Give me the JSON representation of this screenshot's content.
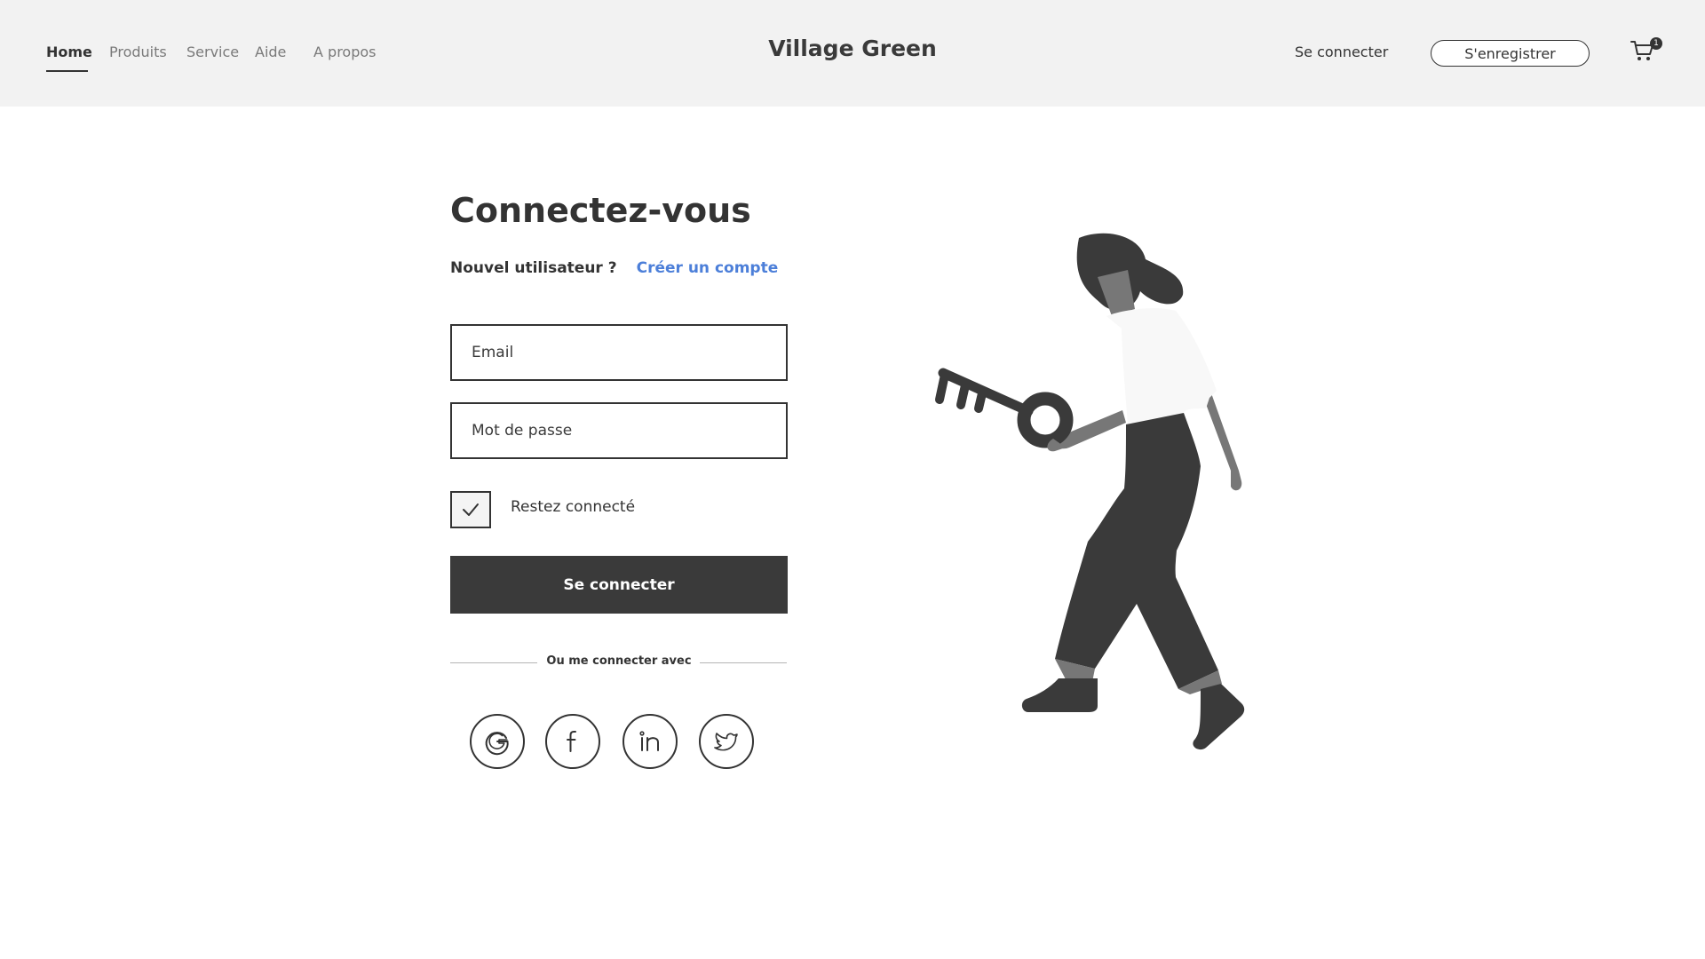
{
  "header": {
    "nav": [
      {
        "label": "Home",
        "active": true
      },
      {
        "label": "Produits",
        "active": false
      },
      {
        "label": "Service",
        "active": false
      },
      {
        "label": "Aide",
        "active": false
      },
      {
        "label": "A propos",
        "active": false
      }
    ],
    "brand": "Village Green",
    "login_label": "Se connecter",
    "register_label": "S'enregistrer",
    "cart_icon": "cart-icon",
    "cart_count": "1"
  },
  "login": {
    "title": "Connectez-vous",
    "new_user_question": "Nouvel utilisateur ?",
    "create_account_link": "Créer un compte",
    "email_placeholder": "Email",
    "password_placeholder": "Mot de passe",
    "remember_label": "Restez connecté",
    "remember_checked": true,
    "submit_label": "Se connecter",
    "divider_text": "Ou me connecter avec",
    "social": [
      "google-icon",
      "facebook-icon",
      "linkedin-icon",
      "twitter-icon"
    ]
  },
  "colors": {
    "header_bg": "#f2f2f2",
    "dark": "#3a3a3a",
    "link": "#4c7fd9",
    "illustration_gray": "#777777"
  }
}
